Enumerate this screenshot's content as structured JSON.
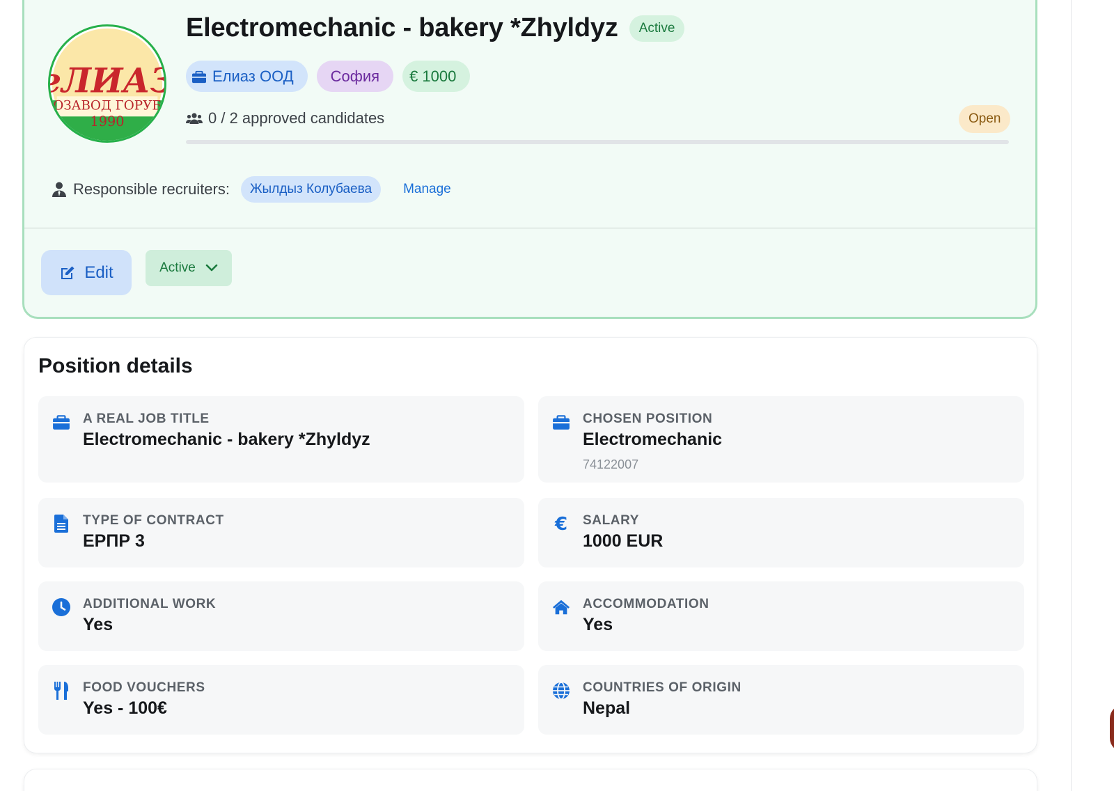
{
  "job": {
    "title": "Electromechanic - bakery *Zhyldyz",
    "status_badge": "Active",
    "company": "Елиаз ООД",
    "city": "София",
    "salary_chip": "€ 1000",
    "candidates_text": "0 / 2 approved candidates",
    "candidates_progress": 0,
    "open_badge": "Open",
    "logo": {
      "top_text": "еЛИАЗ",
      "ring_text": "ОЗАВОД ГОРУБ",
      "year": "1990"
    }
  },
  "recruiters": {
    "label": "Responsible recruiters:",
    "names": [
      "Жылдыз Колубаева"
    ],
    "manage_label": "Manage"
  },
  "actions": {
    "edit_label": "Edit",
    "status_value": "Active"
  },
  "details": {
    "title": "Position details",
    "items": [
      {
        "icon": "briefcase-icon",
        "label": "A REAL JOB TITLE",
        "value": "Electromechanic - bakery *Zhyldyz"
      },
      {
        "icon": "briefcase-icon",
        "label": "CHOSEN POSITION",
        "value": "Electromechanic",
        "sub": "74122007"
      },
      {
        "icon": "document-icon",
        "label": "TYPE OF CONTRACT",
        "value": "ЕРПР 3"
      },
      {
        "icon": "euro-icon",
        "label": "SALARY",
        "value": "1000 EUR"
      },
      {
        "icon": "clock-icon",
        "label": "ADDITIONAL WORK",
        "value": "Yes"
      },
      {
        "icon": "home-icon",
        "label": "ACCOMMODATION",
        "value": "Yes"
      },
      {
        "icon": "utensils-icon",
        "label": "FOOD VOUCHERS",
        "value": "Yes - 100€"
      },
      {
        "icon": "globe-icon",
        "label": "COUNTRIES OF ORIGIN",
        "value": "Nepal"
      }
    ]
  },
  "colors": {
    "accent_blue": "#1a6fd8",
    "active_green": "#1b7a3e",
    "card_border": "#a8dfbd",
    "open_amber": "#8a5a11"
  }
}
